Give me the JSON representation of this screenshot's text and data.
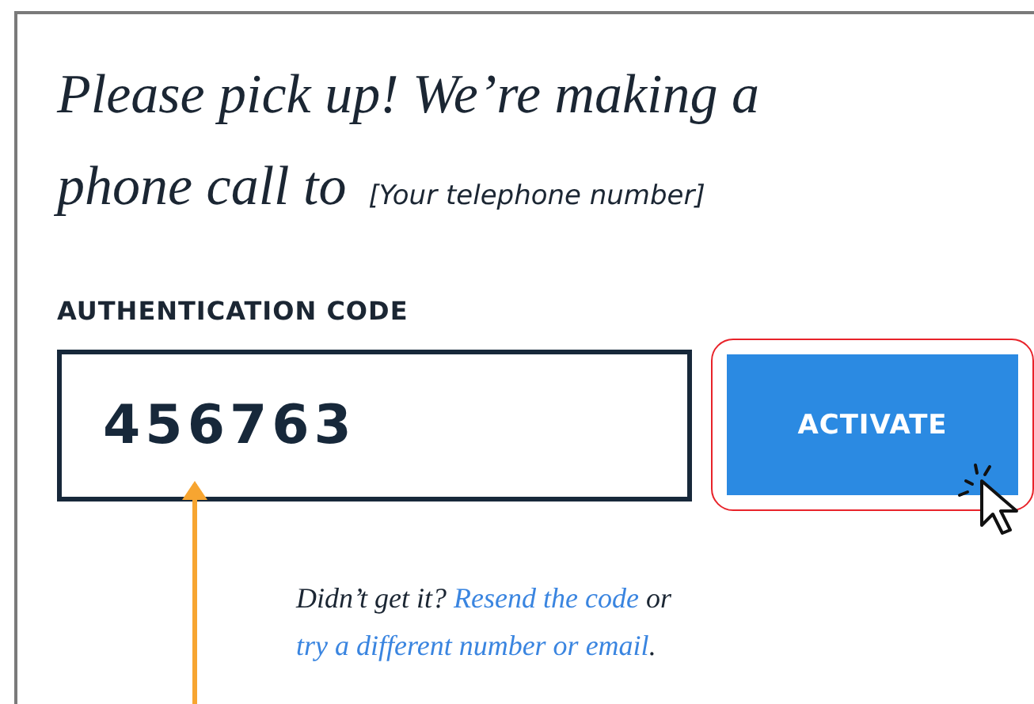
{
  "heading_lines": [
    "Please pick up! We’re making a",
    "phone call to"
  ],
  "phone_number": "[Your telephone number]",
  "code_label": "AUTHENTICATION CODE",
  "code_field": {
    "value": "456763"
  },
  "activate_button": {
    "label": "ACTIVATE",
    "highlighted": true
  },
  "help": {
    "prefix": "Didn’t get it?",
    "resend_link": "Resend the code",
    "middle": "or",
    "alt_link": "try a different number or email",
    "suffix": "."
  }
}
